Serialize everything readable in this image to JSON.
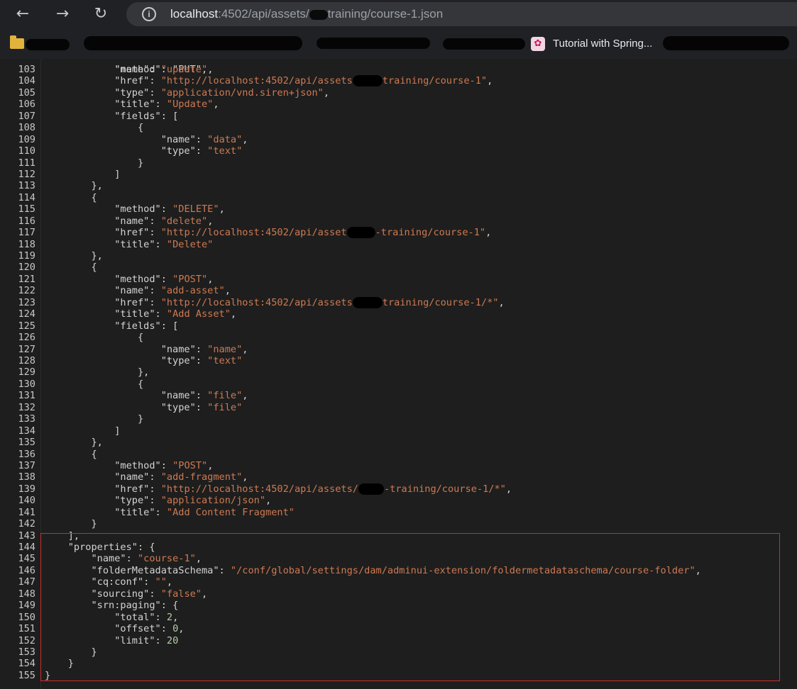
{
  "browser": {
    "nav": {
      "back_icon": "←",
      "forward_icon": "→",
      "reload_icon": "↻"
    },
    "url": {
      "host": "localhost",
      "before_redaction": ":4502/api/assets/",
      "after_redaction": "training/course-1.json"
    },
    "bookmarks": {
      "visible_label": "Tutorial with Spring..."
    }
  },
  "colors": {
    "background": "#1e1e1e",
    "key": "#d4d4d4",
    "string": "#ce7a52",
    "number": "#b5cea8",
    "highlight_border": "#c8302c"
  },
  "code": {
    "partial_first_line": "            \"method\": \"PUT\",",
    "lines": [
      {
        "n": "103",
        "seg": [
          {
            "t": "            "
          },
          {
            "t": "\"name\"",
            "c": "k"
          },
          {
            "t": ": "
          },
          {
            "t": "\"update\"",
            "c": "s"
          },
          {
            "t": ","
          }
        ]
      },
      {
        "n": "104",
        "seg": [
          {
            "t": "            "
          },
          {
            "t": "\"href\"",
            "c": "k"
          },
          {
            "t": ": "
          },
          {
            "t": "\"http://localhost:4502/api/assets",
            "c": "s"
          },
          {
            "r": 42
          },
          {
            "t": "training/course-1\"",
            "c": "s"
          },
          {
            "t": ","
          }
        ]
      },
      {
        "n": "105",
        "seg": [
          {
            "t": "            "
          },
          {
            "t": "\"type\"",
            "c": "k"
          },
          {
            "t": ": "
          },
          {
            "t": "\"application/vnd.siren+json\"",
            "c": "s"
          },
          {
            "t": ","
          }
        ]
      },
      {
        "n": "106",
        "seg": [
          {
            "t": "            "
          },
          {
            "t": "\"title\"",
            "c": "k"
          },
          {
            "t": ": "
          },
          {
            "t": "\"Update\"",
            "c": "s"
          },
          {
            "t": ","
          }
        ]
      },
      {
        "n": "107",
        "seg": [
          {
            "t": "            "
          },
          {
            "t": "\"fields\"",
            "c": "k"
          },
          {
            "t": ": ["
          }
        ]
      },
      {
        "n": "108",
        "seg": [
          {
            "t": "                {"
          }
        ]
      },
      {
        "n": "109",
        "seg": [
          {
            "t": "                    "
          },
          {
            "t": "\"name\"",
            "c": "k"
          },
          {
            "t": ": "
          },
          {
            "t": "\"data\"",
            "c": "s"
          },
          {
            "t": ","
          }
        ]
      },
      {
        "n": "110",
        "seg": [
          {
            "t": "                    "
          },
          {
            "t": "\"type\"",
            "c": "k"
          },
          {
            "t": ": "
          },
          {
            "t": "\"text\"",
            "c": "s"
          }
        ]
      },
      {
        "n": "111",
        "seg": [
          {
            "t": "                }"
          }
        ]
      },
      {
        "n": "112",
        "seg": [
          {
            "t": "            ]"
          }
        ]
      },
      {
        "n": "113",
        "seg": [
          {
            "t": "        },"
          }
        ]
      },
      {
        "n": "114",
        "seg": [
          {
            "t": "        {"
          }
        ]
      },
      {
        "n": "115",
        "seg": [
          {
            "t": "            "
          },
          {
            "t": "\"method\"",
            "c": "k"
          },
          {
            "t": ": "
          },
          {
            "t": "\"DELETE\"",
            "c": "s"
          },
          {
            "t": ","
          }
        ]
      },
      {
        "n": "116",
        "seg": [
          {
            "t": "            "
          },
          {
            "t": "\"name\"",
            "c": "k"
          },
          {
            "t": ": "
          },
          {
            "t": "\"delete\"",
            "c": "s"
          },
          {
            "t": ","
          }
        ]
      },
      {
        "n": "117",
        "seg": [
          {
            "t": "            "
          },
          {
            "t": "\"href\"",
            "c": "k"
          },
          {
            "t": ": "
          },
          {
            "t": "\"http://localhost:4502/api/asset",
            "c": "s"
          },
          {
            "r": 40
          },
          {
            "t": "-training/course-1\"",
            "c": "s"
          },
          {
            "t": ","
          }
        ]
      },
      {
        "n": "118",
        "seg": [
          {
            "t": "            "
          },
          {
            "t": "\"title\"",
            "c": "k"
          },
          {
            "t": ": "
          },
          {
            "t": "\"Delete\"",
            "c": "s"
          }
        ]
      },
      {
        "n": "119",
        "seg": [
          {
            "t": "        },"
          }
        ]
      },
      {
        "n": "120",
        "seg": [
          {
            "t": "        {"
          }
        ]
      },
      {
        "n": "121",
        "seg": [
          {
            "t": "            "
          },
          {
            "t": "\"method\"",
            "c": "k"
          },
          {
            "t": ": "
          },
          {
            "t": "\"POST\"",
            "c": "s"
          },
          {
            "t": ","
          }
        ]
      },
      {
        "n": "122",
        "seg": [
          {
            "t": "            "
          },
          {
            "t": "\"name\"",
            "c": "k"
          },
          {
            "t": ": "
          },
          {
            "t": "\"add-asset\"",
            "c": "s"
          },
          {
            "t": ","
          }
        ]
      },
      {
        "n": "123",
        "seg": [
          {
            "t": "            "
          },
          {
            "t": "\"href\"",
            "c": "k"
          },
          {
            "t": ": "
          },
          {
            "t": "\"http://localhost:4502/api/assets",
            "c": "s"
          },
          {
            "r": 42
          },
          {
            "t": "training/course-1/*\"",
            "c": "s"
          },
          {
            "t": ","
          }
        ]
      },
      {
        "n": "124",
        "seg": [
          {
            "t": "            "
          },
          {
            "t": "\"title\"",
            "c": "k"
          },
          {
            "t": ": "
          },
          {
            "t": "\"Add Asset\"",
            "c": "s"
          },
          {
            "t": ","
          }
        ]
      },
      {
        "n": "125",
        "seg": [
          {
            "t": "            "
          },
          {
            "t": "\"fields\"",
            "c": "k"
          },
          {
            "t": ": ["
          }
        ]
      },
      {
        "n": "126",
        "seg": [
          {
            "t": "                {"
          }
        ]
      },
      {
        "n": "127",
        "seg": [
          {
            "t": "                    "
          },
          {
            "t": "\"name\"",
            "c": "k"
          },
          {
            "t": ": "
          },
          {
            "t": "\"name\"",
            "c": "s"
          },
          {
            "t": ","
          }
        ]
      },
      {
        "n": "128",
        "seg": [
          {
            "t": "                    "
          },
          {
            "t": "\"type\"",
            "c": "k"
          },
          {
            "t": ": "
          },
          {
            "t": "\"text\"",
            "c": "s"
          }
        ]
      },
      {
        "n": "129",
        "seg": [
          {
            "t": "                },"
          }
        ]
      },
      {
        "n": "130",
        "seg": [
          {
            "t": "                {"
          }
        ]
      },
      {
        "n": "131",
        "seg": [
          {
            "t": "                    "
          },
          {
            "t": "\"name\"",
            "c": "k"
          },
          {
            "t": ": "
          },
          {
            "t": "\"file\"",
            "c": "s"
          },
          {
            "t": ","
          }
        ]
      },
      {
        "n": "132",
        "seg": [
          {
            "t": "                    "
          },
          {
            "t": "\"type\"",
            "c": "k"
          },
          {
            "t": ": "
          },
          {
            "t": "\"file\"",
            "c": "s"
          }
        ]
      },
      {
        "n": "133",
        "seg": [
          {
            "t": "                }"
          }
        ]
      },
      {
        "n": "134",
        "seg": [
          {
            "t": "            ]"
          }
        ]
      },
      {
        "n": "135",
        "seg": [
          {
            "t": "        },"
          }
        ]
      },
      {
        "n": "136",
        "seg": [
          {
            "t": "        {"
          }
        ]
      },
      {
        "n": "137",
        "seg": [
          {
            "t": "            "
          },
          {
            "t": "\"method\"",
            "c": "k"
          },
          {
            "t": ": "
          },
          {
            "t": "\"POST\"",
            "c": "s"
          },
          {
            "t": ","
          }
        ]
      },
      {
        "n": "138",
        "seg": [
          {
            "t": "            "
          },
          {
            "t": "\"name\"",
            "c": "k"
          },
          {
            "t": ": "
          },
          {
            "t": "\"add-fragment\"",
            "c": "s"
          },
          {
            "t": ","
          }
        ]
      },
      {
        "n": "139",
        "seg": [
          {
            "t": "            "
          },
          {
            "t": "\"href\"",
            "c": "k"
          },
          {
            "t": ": "
          },
          {
            "t": "\"http://localhost:4502/api/assets/",
            "c": "s"
          },
          {
            "r": 36
          },
          {
            "t": "-training/course-1/*\"",
            "c": "s"
          },
          {
            "t": ","
          }
        ]
      },
      {
        "n": "140",
        "seg": [
          {
            "t": "            "
          },
          {
            "t": "\"type\"",
            "c": "k"
          },
          {
            "t": ": "
          },
          {
            "t": "\"application/json\"",
            "c": "s"
          },
          {
            "t": ","
          }
        ]
      },
      {
        "n": "141",
        "seg": [
          {
            "t": "            "
          },
          {
            "t": "\"title\"",
            "c": "k"
          },
          {
            "t": ": "
          },
          {
            "t": "\"Add Content Fragment\"",
            "c": "s"
          }
        ]
      },
      {
        "n": "142",
        "seg": [
          {
            "t": "        }"
          }
        ]
      },
      {
        "n": "143",
        "seg": [
          {
            "t": "    ],"
          }
        ]
      },
      {
        "n": "144",
        "seg": [
          {
            "t": "    "
          },
          {
            "t": "\"properties\"",
            "c": "k"
          },
          {
            "t": ": {"
          }
        ]
      },
      {
        "n": "145",
        "seg": [
          {
            "t": "        "
          },
          {
            "t": "\"name\"",
            "c": "k"
          },
          {
            "t": ": "
          },
          {
            "t": "\"course-1\"",
            "c": "s"
          },
          {
            "t": ","
          }
        ]
      },
      {
        "n": "146",
        "seg": [
          {
            "t": "        "
          },
          {
            "t": "\"folderMetadataSchema\"",
            "c": "k"
          },
          {
            "t": ": "
          },
          {
            "t": "\"/conf/global/settings/dam/adminui-extension/foldermetadataschema/course-folder\"",
            "c": "s"
          },
          {
            "t": ","
          }
        ]
      },
      {
        "n": "147",
        "seg": [
          {
            "t": "        "
          },
          {
            "t": "\"cq:conf\"",
            "c": "k"
          },
          {
            "t": ": "
          },
          {
            "t": "\"\"",
            "c": "s"
          },
          {
            "t": ","
          }
        ]
      },
      {
        "n": "148",
        "seg": [
          {
            "t": "        "
          },
          {
            "t": "\"sourcing\"",
            "c": "k"
          },
          {
            "t": ": "
          },
          {
            "t": "\"false\"",
            "c": "s"
          },
          {
            "t": ","
          }
        ]
      },
      {
        "n": "149",
        "seg": [
          {
            "t": "        "
          },
          {
            "t": "\"srn:paging\"",
            "c": "k"
          },
          {
            "t": ": {"
          }
        ]
      },
      {
        "n": "150",
        "seg": [
          {
            "t": "            "
          },
          {
            "t": "\"total\"",
            "c": "k"
          },
          {
            "t": ": "
          },
          {
            "t": "2",
            "c": "n"
          },
          {
            "t": ","
          }
        ]
      },
      {
        "n": "151",
        "seg": [
          {
            "t": "            "
          },
          {
            "t": "\"offset\"",
            "c": "k"
          },
          {
            "t": ": "
          },
          {
            "t": "0",
            "c": "n"
          },
          {
            "t": ","
          }
        ]
      },
      {
        "n": "152",
        "seg": [
          {
            "t": "            "
          },
          {
            "t": "\"limit\"",
            "c": "k"
          },
          {
            "t": ": "
          },
          {
            "t": "20",
            "c": "n"
          }
        ]
      },
      {
        "n": "153",
        "seg": [
          {
            "t": "        }"
          }
        ]
      },
      {
        "n": "154",
        "seg": [
          {
            "t": "    }"
          }
        ]
      },
      {
        "n": "155",
        "seg": [
          {
            "t": "}"
          }
        ]
      }
    ]
  }
}
